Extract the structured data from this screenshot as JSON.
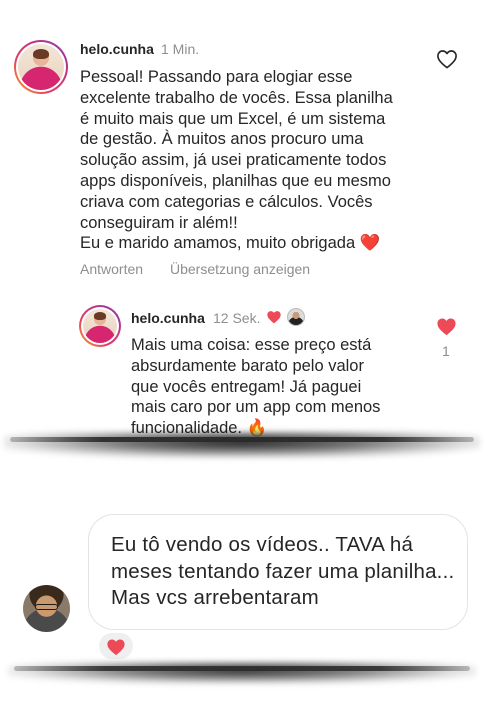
{
  "comments_panel": {
    "main_comment": {
      "username": "helo.cunha",
      "time": "1 Min.",
      "text": "Pessoal! Passando para elogiar esse\nexcelente trabalho de vocês. Essa planilha\né muito mais que um Excel, é um sistema\nde gestão. À muitos anos procuro uma\nsolução assim, já usei praticamente todos\napps disponíveis, planilhas que eu mesmo\ncriava com categorias e cálculos. Vocês\nconseguiram ir além!!\nEu e marido amamos, muito obrigada ❤️",
      "reply_label": "Antworten",
      "translate_label": "Übersetzung anzeigen",
      "like_icon": "heart-outline-icon"
    },
    "reply_comment": {
      "username": "helo.cunha",
      "time": "12 Sek.",
      "creator_liked_icon": "red-heart-icon",
      "text": "Mais uma coisa: esse preço está\nabsurdamente barato pelo valor\nque vocês entregam! Já paguei\nmais caro por um app com menos\nfuncionalidade. 🔥",
      "like_count": "1",
      "like_icon": "red-heart-icon"
    }
  },
  "message_panel": {
    "message_text": "Eu tô vendo os vídeos.. TAVA há meses tentando fazer uma planilha... Mas vcs arrebentaram",
    "reaction_icon": "red-heart-icon"
  },
  "colors": {
    "heart_red": "#ed4956",
    "secondary_text": "#8e8e8e",
    "primary_text": "#262626"
  }
}
